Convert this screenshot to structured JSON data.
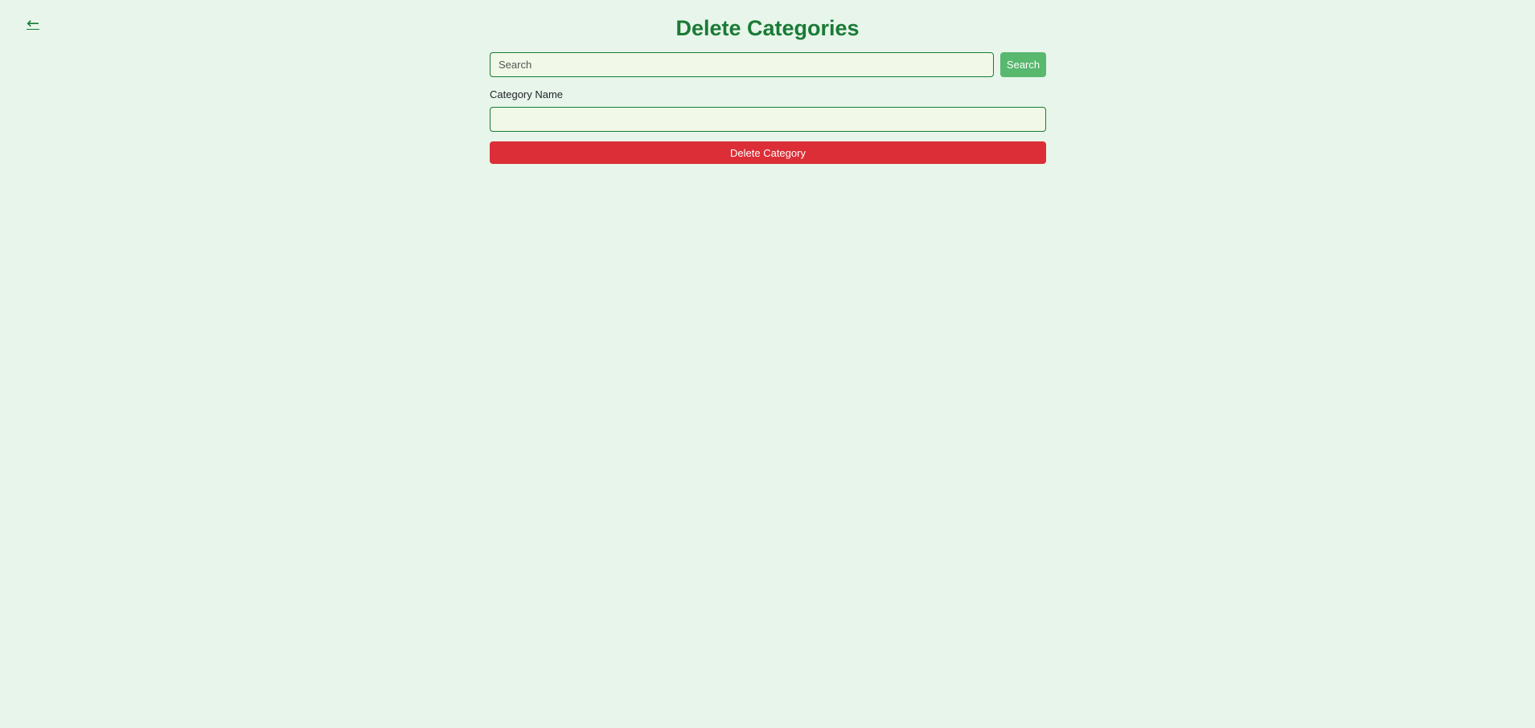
{
  "nav": {
    "back_label": "←"
  },
  "page": {
    "title": "Delete Categories"
  },
  "search": {
    "placeholder": "Search",
    "value": "",
    "button_label": "Search"
  },
  "form": {
    "category_name_label": "Category Name",
    "category_name_value": "",
    "delete_button_label": "Delete Category"
  },
  "colors": {
    "background": "#e7f5ea",
    "accent": "#1a7a36",
    "search_button": "#57b86e",
    "danger": "#dc2e37",
    "input_background": "#f1f8e7"
  },
  "icons": {
    "back": "arrow-left-icon"
  }
}
